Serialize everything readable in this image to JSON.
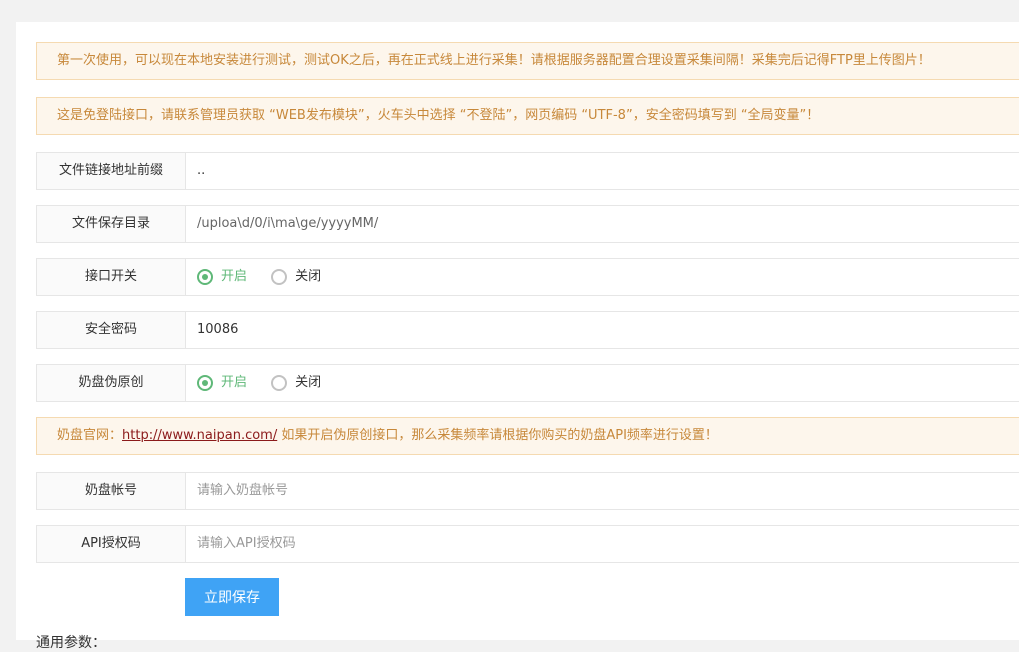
{
  "notices": {
    "first": "第一次使用，可以现在本地安装进行测试，测试OK之后，再在正式线上进行采集！请根据服务器配置合理设置采集间隔！采集完后记得FTP里上传图片！",
    "second": "这是免登陆接口，请联系管理员获取 “WEB发布模块”，火车头中选择 “不登陆”，网页编码 “UTF-8”，安全密码填写到 “全局变量”！",
    "naipan_prefix": "奶盘官网：",
    "naipan_link": "http://www.naipan.com/",
    "naipan_suffix": " 如果开启伪原创接口，那么采集频率请根据你购买的奶盘API频率进行设置！"
  },
  "form": {
    "file_url_prefix": {
      "label": "文件链接地址前缀",
      "value": ".."
    },
    "file_save_dir": {
      "label": "文件保存目录",
      "value": "/uploa\\d/0/i\\ma\\ge/yyyyMM/"
    },
    "api_switch": {
      "label": "接口开关",
      "on": "开启",
      "off": "关闭",
      "selected": "开启"
    },
    "security_password": {
      "label": "安全密码",
      "value": "10086"
    },
    "naipan_pseudo": {
      "label": "奶盘伪原创",
      "on": "开启",
      "off": "关闭",
      "selected": "开启"
    },
    "naipan_account": {
      "label": "奶盘帐号",
      "placeholder": "请输入奶盘帐号"
    },
    "api_auth_code": {
      "label": "API授权码",
      "placeholder": "请输入API授权码"
    }
  },
  "save_button": "立即保存",
  "section_title": "通用参数：",
  "colors": {
    "notice_bg": "#fdf6ec",
    "notice_text": "#c7883a",
    "radio_checked": "#5fb878",
    "button": "#3fa3f5"
  }
}
